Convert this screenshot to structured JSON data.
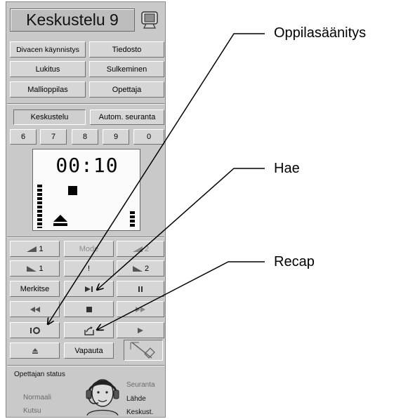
{
  "title": "Keskustelu 9",
  "top_buttons": [
    "Divacen käynnistys",
    "Tiedosto",
    "Lukitus",
    "Sulkeminen",
    "Mallioppilas",
    "Opettaja"
  ],
  "mode_tabs": [
    "Keskustelu",
    "Autom. seuranta"
  ],
  "channel_buttons": [
    "6",
    "7",
    "8",
    "9",
    "0"
  ],
  "timer": "00:10",
  "controls": {
    "vol1": "1",
    "mode": "Mode",
    "vol2": "2",
    "bal1": "1",
    "excl": "!",
    "bal2": "2",
    "merkitse": "Merkitse",
    "vapauta": "Vapauta"
  },
  "status": {
    "heading": "Opettajan status",
    "left": [
      "Normaali",
      "Kutsu"
    ],
    "right": [
      "Seuranta",
      "Lähde",
      "Keskust."
    ]
  },
  "callouts": [
    "Oppilasäänitys",
    "Hae",
    "Recap"
  ],
  "colors": {
    "panel": "#c9c9c9",
    "button": "#d6d6d6",
    "display": "#fafafa"
  }
}
